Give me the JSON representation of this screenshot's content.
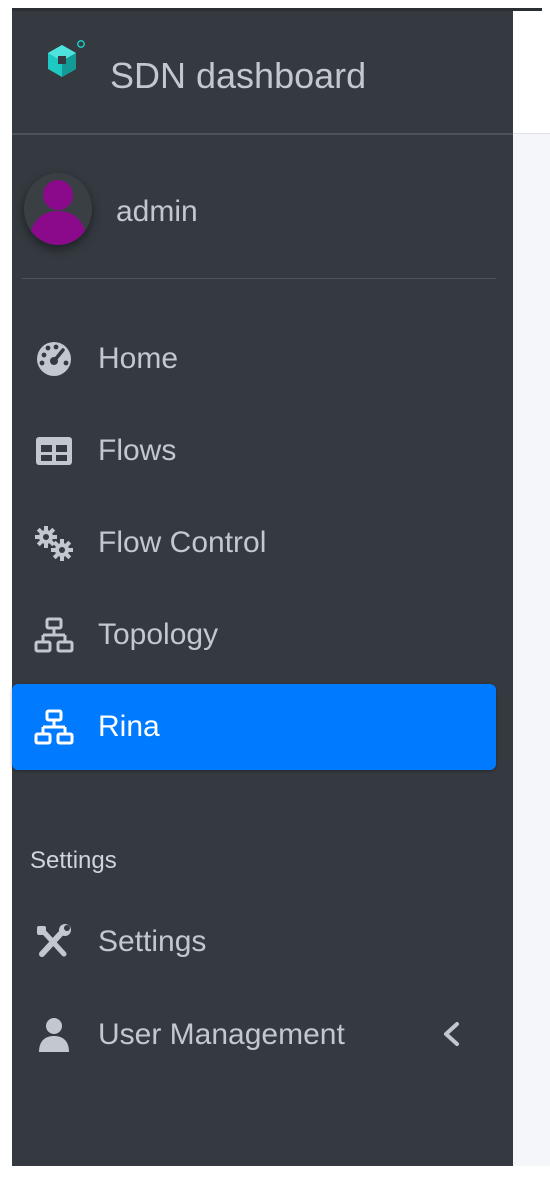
{
  "brand": {
    "title": "SDN dashboard",
    "logo_icon": "cube-logo-icon",
    "accent": "#1ec9c4"
  },
  "user": {
    "name": "admin",
    "avatar_icon": "user-avatar-icon",
    "avatar_color": "#8b0a8b"
  },
  "nav": {
    "items": [
      {
        "label": "Home",
        "icon": "tachometer-icon",
        "active": false
      },
      {
        "label": "Flows",
        "icon": "table-icon",
        "active": false
      },
      {
        "label": "Flow Control",
        "icon": "cogs-icon",
        "active": false
      },
      {
        "label": "Topology",
        "icon": "sitemap-icon",
        "active": false
      },
      {
        "label": "Rina",
        "icon": "sitemap-icon",
        "active": true
      }
    ],
    "settings_header": "Settings",
    "settings_items": [
      {
        "label": "Settings",
        "icon": "tools-icon"
      },
      {
        "label": "User Management",
        "icon": "user-icon",
        "has_submenu": true,
        "chevron_icon": "chevron-left-icon"
      }
    ]
  },
  "colors": {
    "sidebar_bg": "#343a40",
    "active_bg": "#007bff",
    "text": "#c2c7d0"
  }
}
